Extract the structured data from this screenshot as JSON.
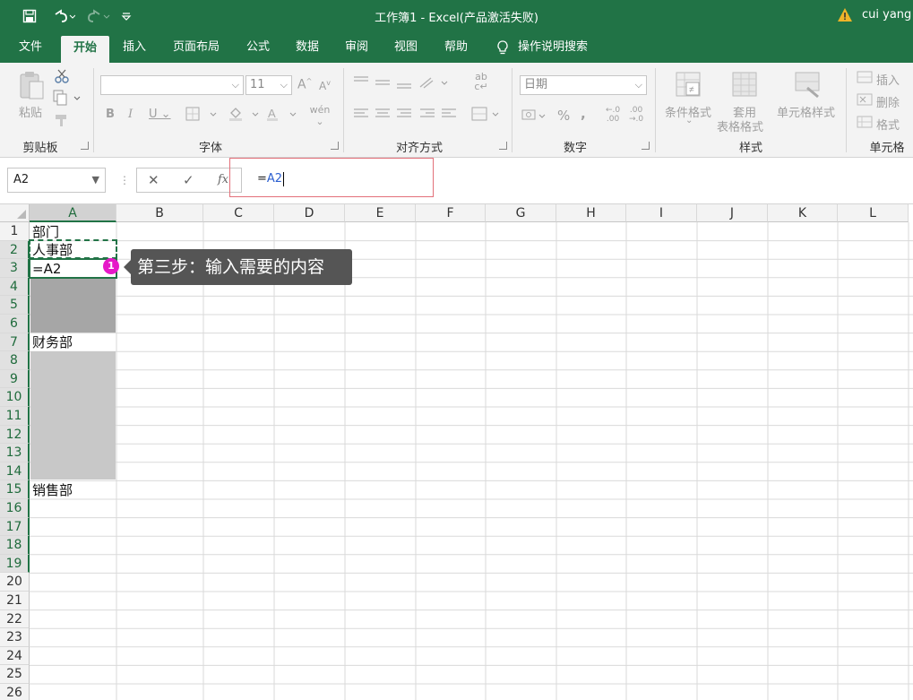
{
  "window": {
    "title": "工作簿1  -  Excel(产品激活失败)",
    "user": "cui yang"
  },
  "tabs": [
    {
      "label": "文件",
      "active": false
    },
    {
      "label": "开始",
      "active": true
    },
    {
      "label": "插入",
      "active": false
    },
    {
      "label": "页面布局",
      "active": false
    },
    {
      "label": "公式",
      "active": false
    },
    {
      "label": "数据",
      "active": false
    },
    {
      "label": "审阅",
      "active": false
    },
    {
      "label": "视图",
      "active": false
    },
    {
      "label": "帮助",
      "active": false
    }
  ],
  "tell_me": "操作说明搜索",
  "ribbon": {
    "clipboard": {
      "label": "剪贴板",
      "paste": "粘贴"
    },
    "font": {
      "label": "字体",
      "font_name": "",
      "font_size": "11"
    },
    "alignment": {
      "label": "对齐方式"
    },
    "number": {
      "label": "数字",
      "format": "日期"
    },
    "styles": {
      "label": "样式",
      "conditional": "条件格式",
      "table_line1": "套用",
      "table_line2": "表格格式",
      "cell_styles": "单元格样式"
    },
    "cells": {
      "label": "单元格",
      "insert": "插入",
      "delete": "删除",
      "format": "格式"
    }
  },
  "formula_bar": {
    "name_box": "A2",
    "formula_prefix": "=",
    "formula_ref": "A2"
  },
  "columns": [
    "A",
    "B",
    "C",
    "D",
    "E",
    "F",
    "G",
    "H",
    "I",
    "J",
    "K",
    "L"
  ],
  "rows": [
    "1",
    "2",
    "3",
    "4",
    "5",
    "6",
    "7",
    "8",
    "9",
    "10",
    "11",
    "12",
    "13",
    "14",
    "15",
    "16",
    "17",
    "18",
    "19",
    "20",
    "21",
    "22",
    "23",
    "24",
    "25",
    "26"
  ],
  "cells": {
    "A1": "部门",
    "A2": "人事部",
    "A3": "=A2",
    "A7": "财务部",
    "A15": "销售部"
  },
  "tooltip": {
    "badge": "1",
    "text": "第三步：输入需要的内容"
  },
  "colors": {
    "accent": "#217346",
    "badge": "#e619c8",
    "highlight_box": "#e3707a"
  }
}
